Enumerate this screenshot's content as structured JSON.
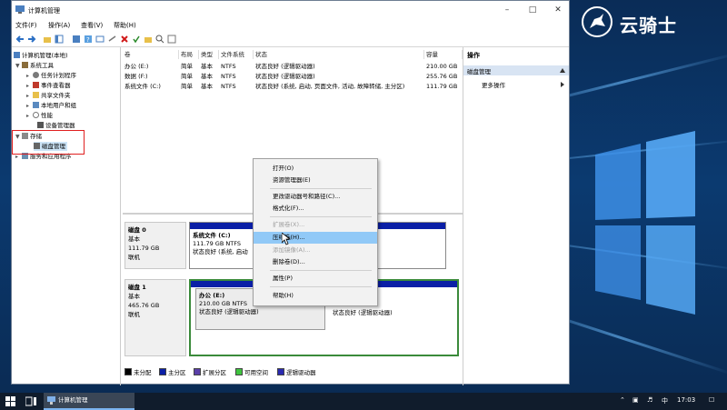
{
  "window": {
    "title": "计算机管理",
    "menus": [
      "文件(F)",
      "操作(A)",
      "查看(V)",
      "帮助(H)"
    ]
  },
  "tree": {
    "root": "计算机管理(本地)",
    "system_tools": "系统工具",
    "task_scheduler": "任务计划程序",
    "event_viewer": "事件查看器",
    "shared_folders": "共享文件夹",
    "local_users": "本地用户和组",
    "performance": "性能",
    "device_manager": "设备管理器",
    "storage": "存储",
    "disk_management": "磁盘管理",
    "services_apps": "服务和应用程序"
  },
  "volume_list": {
    "columns": [
      "卷",
      "布局",
      "类型",
      "文件系统",
      "状态",
      "容量"
    ],
    "rows": [
      {
        "volume": "办公 (E:)",
        "layout": "简单",
        "type": "基本",
        "fs": "NTFS",
        "status": "状态良好 (逻辑驱动器)",
        "capacity": "210.00 GB"
      },
      {
        "volume": "数据 (F:)",
        "layout": "简单",
        "type": "基本",
        "fs": "NTFS",
        "status": "状态良好 (逻辑驱动器)",
        "capacity": "255.76 GB"
      },
      {
        "volume": "系统文件 (C:)",
        "layout": "简单",
        "type": "基本",
        "fs": "NTFS",
        "status": "状态良好 (系统, 启动, 页面文件, 活动, 故障转储, 主分区)",
        "capacity": "111.79 GB"
      }
    ]
  },
  "disks": [
    {
      "name": "磁盘 0",
      "type": "基本",
      "size": "111.79 GB",
      "state": "联机",
      "partition": {
        "name": "系统文件 (C:)",
        "info": "111.79 GB NTFS",
        "status": "状态良好 (系统, 启动"
      }
    },
    {
      "name": "磁盘 1",
      "type": "基本",
      "size": "465.76 GB",
      "state": "联机",
      "partition": {
        "name": "办公 (E:)",
        "info": "210.00 GB NTFS",
        "status": "状态良好 (逻辑驱动器)"
      },
      "partition2": {
        "status": "状态良好 (逻辑驱动器)"
      }
    }
  ],
  "legend": [
    "未分配",
    "主分区",
    "扩展分区",
    "可用空间",
    "逻辑驱动器"
  ],
  "legend_colors": [
    "#000000",
    "#0b1fa6",
    "#5a3fa8",
    "#3fc43f",
    "#2a2ab0"
  ],
  "actions": {
    "title": "操作",
    "section": "磁盘管理",
    "more": "更多操作"
  },
  "context_menu": {
    "open": "打开(O)",
    "explore": "资源管理器(E)",
    "change_letter": "更改驱动器号和路径(C)...",
    "format": "格式化(F)...",
    "extend": "扩展卷(X)...",
    "shrink": "压缩卷(H)...",
    "add_mirror": "添加镜像(A)...",
    "delete": "删除卷(D)...",
    "properties": "属性(P)",
    "help": "帮助(H)"
  },
  "brand": {
    "name": "云骑士"
  },
  "taskbar": {
    "task_label": "计算机管理",
    "ime": "中",
    "clock": "17:03"
  }
}
